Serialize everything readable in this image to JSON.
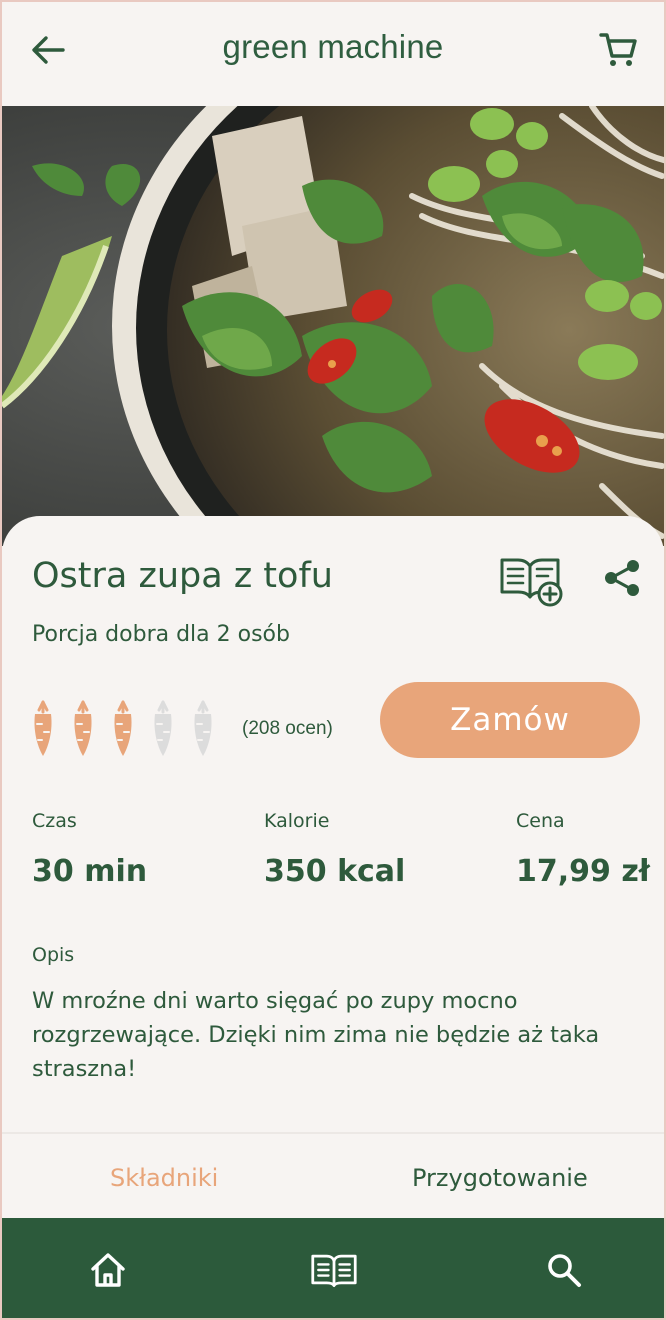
{
  "header": {
    "title": "green machine",
    "back_icon": "arrow-left-icon",
    "cart_icon": "cart-icon"
  },
  "hero": {
    "image": "spicy tofu soup bowl photo"
  },
  "recipe": {
    "title": "Ostra zupa z tofu",
    "portion": "Porcja dobra dla 2 osób",
    "rating": 3,
    "rating_max": 5,
    "rating_count": "(208 ocen)",
    "order_label": "Zamów",
    "stats": [
      {
        "label": "Czas",
        "value": "30 min"
      },
      {
        "label": "Kalorie",
        "value": "350 kcal"
      },
      {
        "label": "Cena",
        "value": "17,99 zł"
      }
    ],
    "description_label": "Opis",
    "description": "W mroźne dni warto sięgać po zupy mocno rozgrzewające. Dzięki nim zima nie będzie aż taka straszna!"
  },
  "tabs": [
    {
      "label": "Składniki",
      "active": true
    },
    {
      "label": "Przygotowanie",
      "active": false
    }
  ],
  "bottom_nav": [
    {
      "icon": "home-icon"
    },
    {
      "icon": "recipe-book-icon"
    },
    {
      "icon": "search-icon"
    }
  ],
  "colors": {
    "primary_green": "#2e5a3c",
    "accent_orange": "#e8a57a",
    "background": "#f7f4f2",
    "inactive_carrot": "#dcdcdc"
  }
}
